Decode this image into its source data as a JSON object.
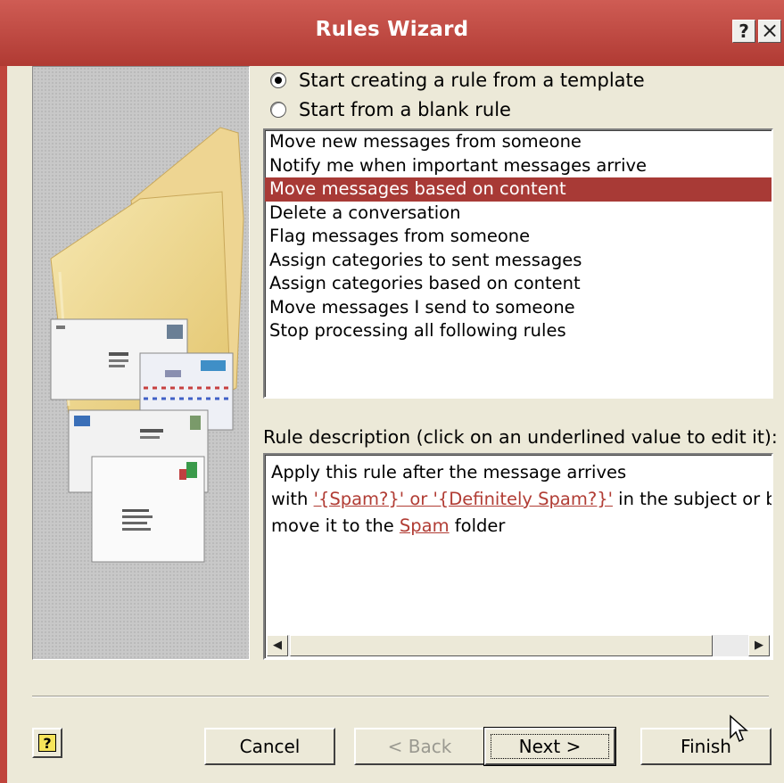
{
  "window": {
    "title": "Rules Wizard",
    "help_title_btn": "?",
    "close_title_btn": "×"
  },
  "options": {
    "template": {
      "label": "Start creating a rule from a template",
      "checked": true
    },
    "blank": {
      "label": "Start from a blank rule",
      "checked": false
    }
  },
  "templates": {
    "items": [
      "Move new messages from someone",
      "Notify me when important messages arrive",
      "Move messages based on content",
      "Delete a conversation",
      "Flag messages from someone",
      "Assign categories to sent messages",
      "Assign categories based on content",
      "Move messages I send to someone",
      "Stop processing all following rules"
    ],
    "selected_index": 2
  },
  "description": {
    "label": "Rule description (click on an underlined value to edit it):",
    "line1": "Apply this rule after the message arrives",
    "line2_prefix": "with ",
    "line2_link": "'{Spam?}' or '{Definitely Spam?}'",
    "line2_suffix": " in the subject or body",
    "line3_prefix": "move it to the ",
    "line3_link": "Spam",
    "line3_suffix": " folder"
  },
  "buttons": {
    "help": "?",
    "cancel": "Cancel",
    "back": "< Back",
    "next": "Next >",
    "finish": "Finish"
  },
  "colors": {
    "title_bar": "#c0443c",
    "selection": "#a83a36",
    "link": "#b13c34",
    "dialog_bg": "#ece9d8"
  }
}
